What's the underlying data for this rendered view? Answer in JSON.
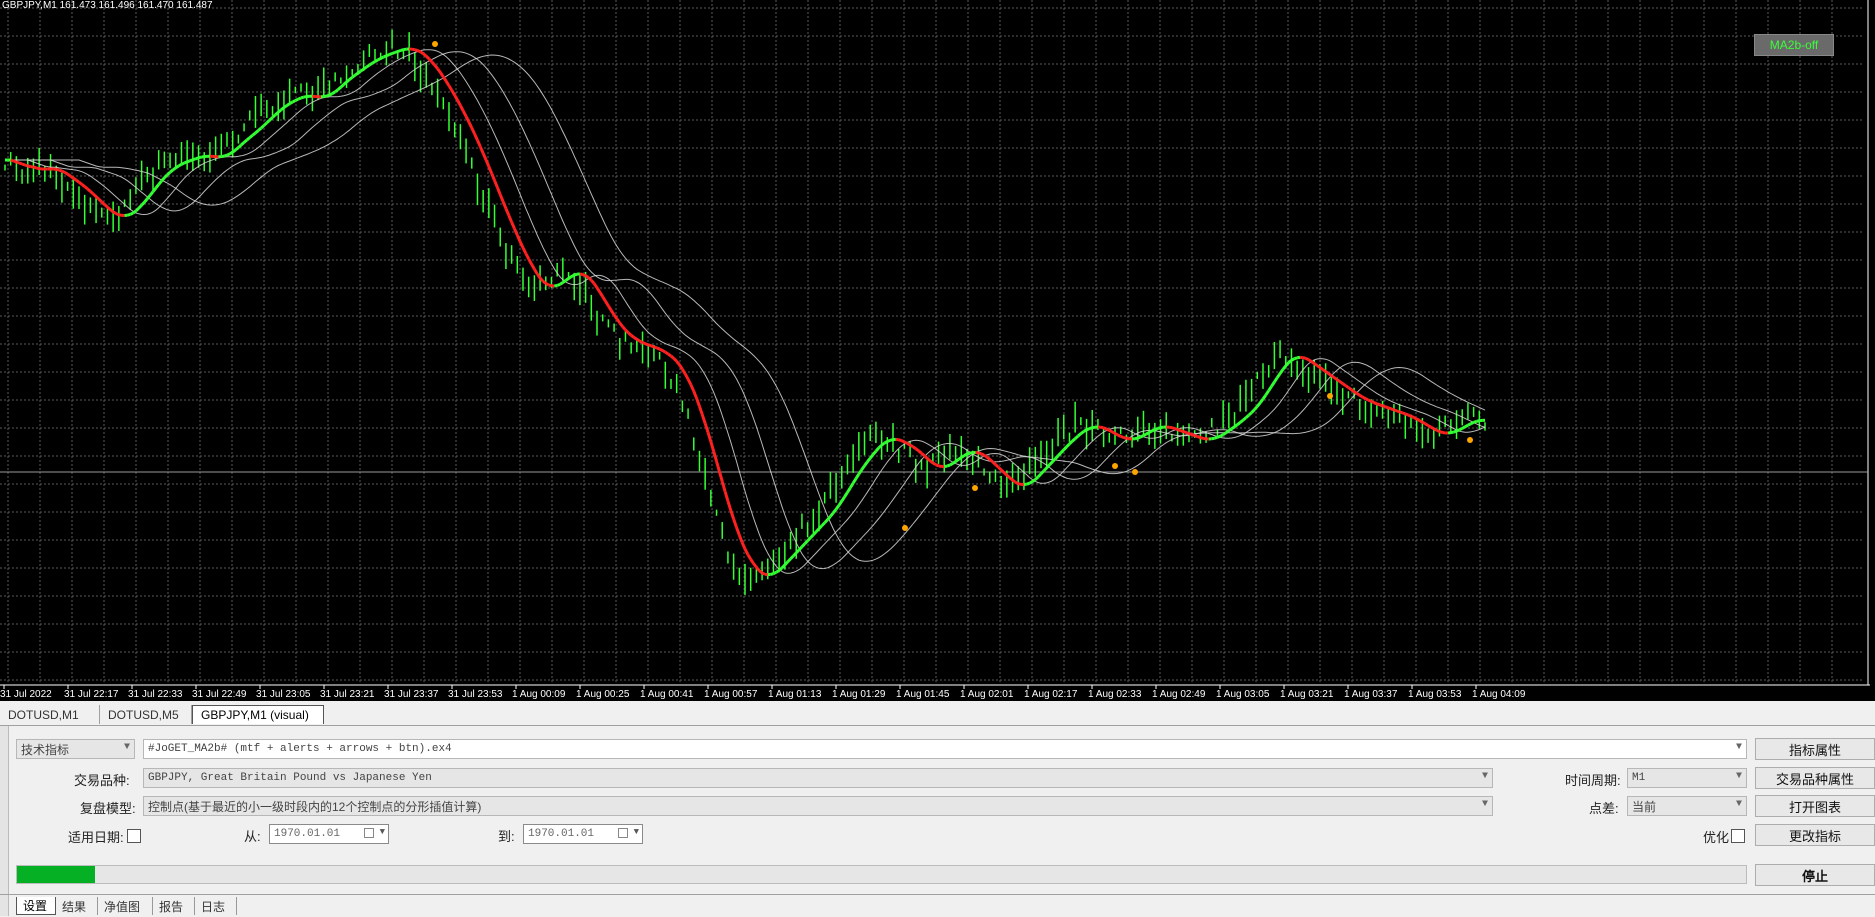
{
  "chart": {
    "title": "GBPJPY,M1  161.473 161.496 161.470 161.487",
    "ma_button": "MA2b-off",
    "time_labels": [
      "31 Jul 2022",
      "31 Jul 22:17",
      "31 Jul 22:33",
      "31 Jul 22:49",
      "31 Jul 23:05",
      "31 Jul 23:21",
      "31 Jul 23:37",
      "31 Jul 23:53",
      "1 Aug 00:09",
      "1 Aug 00:25",
      "1 Aug 00:41",
      "1 Aug 00:57",
      "1 Aug 01:13",
      "1 Aug 01:29",
      "1 Aug 01:45",
      "1 Aug 02:01",
      "1 Aug 02:17",
      "1 Aug 02:33",
      "1 Aug 02:49",
      "1 Aug 03:05",
      "1 Aug 03:21",
      "1 Aug 03:37",
      "1 Aug 03:53",
      "1 Aug 04:09"
    ],
    "price_shape": [
      0.8,
      0.78,
      0.79,
      0.77,
      0.75,
      0.72,
      0.7,
      0.72,
      0.76,
      0.79,
      0.8,
      0.81,
      0.8,
      0.83,
      0.85,
      0.88,
      0.9,
      0.91,
      0.9,
      0.93,
      0.95,
      0.97,
      0.98,
      0.99,
      0.97,
      0.93,
      0.88,
      0.82,
      0.75,
      0.68,
      0.62,
      0.58,
      0.6,
      0.62,
      0.58,
      0.53,
      0.5,
      0.49,
      0.48,
      0.45,
      0.38,
      0.28,
      0.18,
      0.12,
      0.1,
      0.13,
      0.16,
      0.19,
      0.22,
      0.27,
      0.31,
      0.34,
      0.33,
      0.31,
      0.28,
      0.3,
      0.32,
      0.3,
      0.27,
      0.25,
      0.28,
      0.31,
      0.34,
      0.36,
      0.35,
      0.33,
      0.34,
      0.36,
      0.35,
      0.34,
      0.33,
      0.35,
      0.37,
      0.4,
      0.45,
      0.48,
      0.46,
      0.44,
      0.42,
      0.4,
      0.39,
      0.38,
      0.37,
      0.35,
      0.34,
      0.36,
      0.37,
      0.36
    ],
    "colors": {
      "bg": "#000000",
      "grid": "#5a5a5a",
      "candle": "#33ff33",
      "ma_up": "#33ff33",
      "ma_down": "#ff2020",
      "ma_thin": "#d8d8d8",
      "dot": "#ffa500",
      "axis_text": "#ffffff"
    }
  },
  "chart_tabs": [
    {
      "label": "DOTUSD,M1",
      "active": false
    },
    {
      "label": "DOTUSD,M5",
      "active": false
    },
    {
      "label": "GBPJPY,M1 (visual)",
      "active": true
    }
  ],
  "tester": {
    "type_select": "技术指标",
    "expert_file": "#JoGET_MA2b# (mtf + alerts + arrows + btn).ex4",
    "symbol_label": "交易品种:",
    "symbol_value": "GBPJPY, Great Britain Pound vs Japanese Yen",
    "model_label": "复盘模型:",
    "model_value": "控制点(基于最近的小一级时段内的12个控制点的分形插值计算)",
    "use_date_label": "适用日期:",
    "from_label": "从:",
    "from_value": "1970.01.01",
    "to_label": "到:",
    "to_value": "1970.01.01",
    "period_label": "时间周期:",
    "period_value": "M1",
    "spread_label": "点差:",
    "spread_value": "当前",
    "optimize_label": "优化",
    "buttons": {
      "indicator_props": "指标属性",
      "symbol_props": "交易品种属性",
      "open_chart": "打开图表",
      "modify_indicator": "更改指标",
      "stop": "停止"
    },
    "progress": 0.045
  },
  "bottom_tabs": [
    {
      "label": "设置",
      "active": true
    },
    {
      "label": "结果",
      "active": false
    },
    {
      "label": "净值图",
      "active": false
    },
    {
      "label": "报告",
      "active": false
    },
    {
      "label": "日志",
      "active": false
    }
  ]
}
